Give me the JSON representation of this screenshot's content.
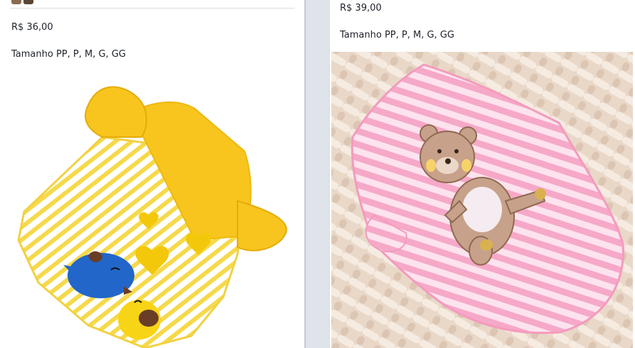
{
  "posts": [
    {
      "price": "R$ 36,00",
      "sizes": "Tamanho PP, P, M, G, GG",
      "image_name": "yellow-striped-pet-shirt-with-birds"
    },
    {
      "price": "R$ 39,00",
      "sizes": "Tamanho PP, P, M, G, GG",
      "image_name": "pink-striped-pet-shirt-with-teddy-bear"
    }
  ],
  "colors": {
    "page_bg": "#e9ebee",
    "card_bg": "#ffffff",
    "text": "#1d2129",
    "shirt_yellow": "#f7c51d",
    "shirt_pink": "#f7a9c8"
  }
}
